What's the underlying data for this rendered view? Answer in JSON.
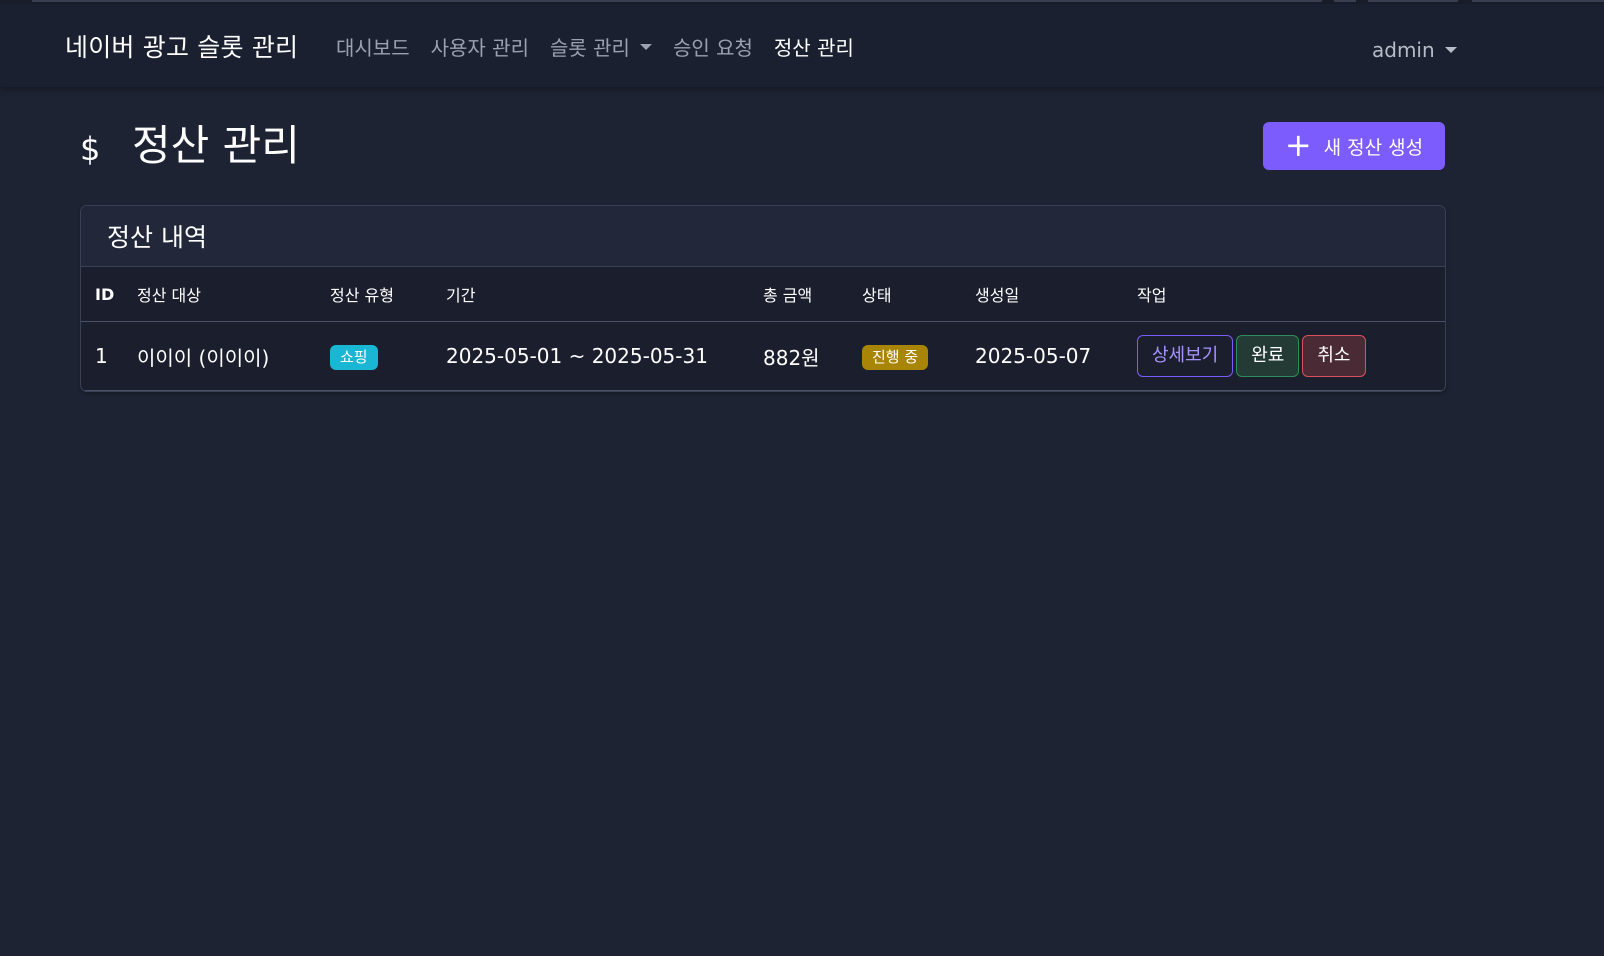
{
  "navbar": {
    "brand": "네이버 광고 슬롯 관리",
    "links": [
      {
        "label": "대시보드",
        "active": false
      },
      {
        "label": "사용자 관리",
        "active": false
      },
      {
        "label": "슬롯 관리",
        "active": false
      },
      {
        "label": "승인 요청",
        "active": false
      },
      {
        "label": "정산 관리",
        "active": true
      }
    ],
    "user": "admin"
  },
  "page": {
    "title": "정산 관리",
    "title_icon": "dollar-icon",
    "new_button": {
      "label": "새 정산 생성",
      "icon": "plus-icon"
    }
  },
  "card": {
    "header": "정산 내역",
    "columns": [
      "ID",
      "정산 대상",
      "정산 유형",
      "기간",
      "총 금액",
      "상태",
      "생성일",
      "작업"
    ],
    "rows": [
      {
        "id": "1",
        "target": "이이이 (이이이)",
        "type": "쇼핑",
        "period": "2025-05-01 ~ 2025-05-31",
        "amount": "882원",
        "status": "진행 중",
        "created": "2025-05-07",
        "actions": {
          "detail": "상세보기",
          "complete": "완료",
          "cancel": "취소"
        }
      }
    ]
  },
  "colors": {
    "background": "#1e2333",
    "navbar": "#1b2030",
    "primary": "#7c5cfc",
    "badge_type": "#1ab7d4",
    "badge_status": "#a88504",
    "success": "#2c8d5a",
    "danger": "#d8515c"
  }
}
